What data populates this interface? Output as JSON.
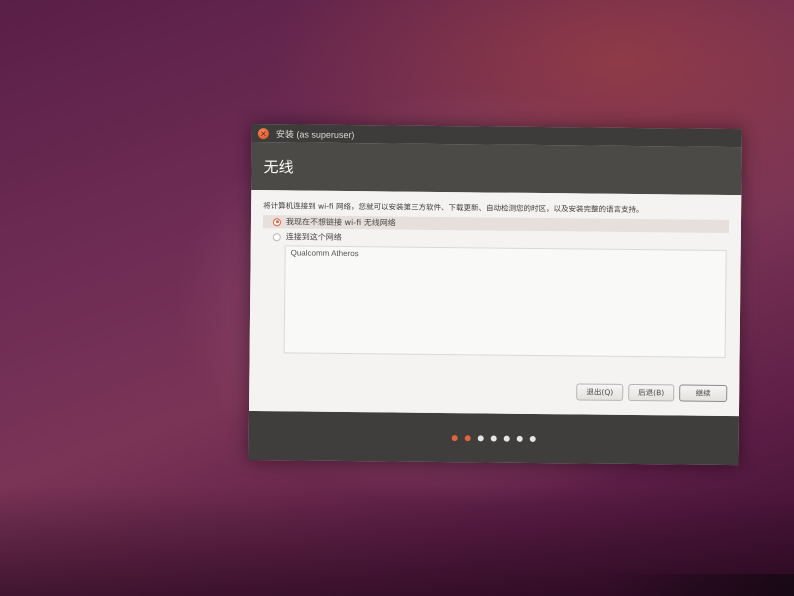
{
  "window": {
    "title": "安装 (as superuser)",
    "close_glyph": "×"
  },
  "page": {
    "title": "无线",
    "description": "将计算机连接到 wi-fi 网络，您就可以安装第三方软件、下载更新、自动检测您的时区，以及安装完整的语言支持。"
  },
  "options": {
    "no_wifi": {
      "label": "我现在不想链接 wi-fi 无线网络",
      "selected": true
    },
    "connect": {
      "label": "连接到这个网络",
      "selected": false
    }
  },
  "network_list": {
    "items": [
      "Qualcomm Atheros"
    ]
  },
  "buttons": {
    "quit": "退出(Q)",
    "back": "后退(B)",
    "continue": "继续"
  },
  "progress": {
    "total_steps": 7,
    "completed_steps": 2
  },
  "colors": {
    "accent": "#e2643c",
    "titlebar": "#3d3c3a",
    "header": "#4b4a47"
  },
  "icons": {
    "close": "close-icon",
    "cursor": "mouse-pointer-icon"
  }
}
